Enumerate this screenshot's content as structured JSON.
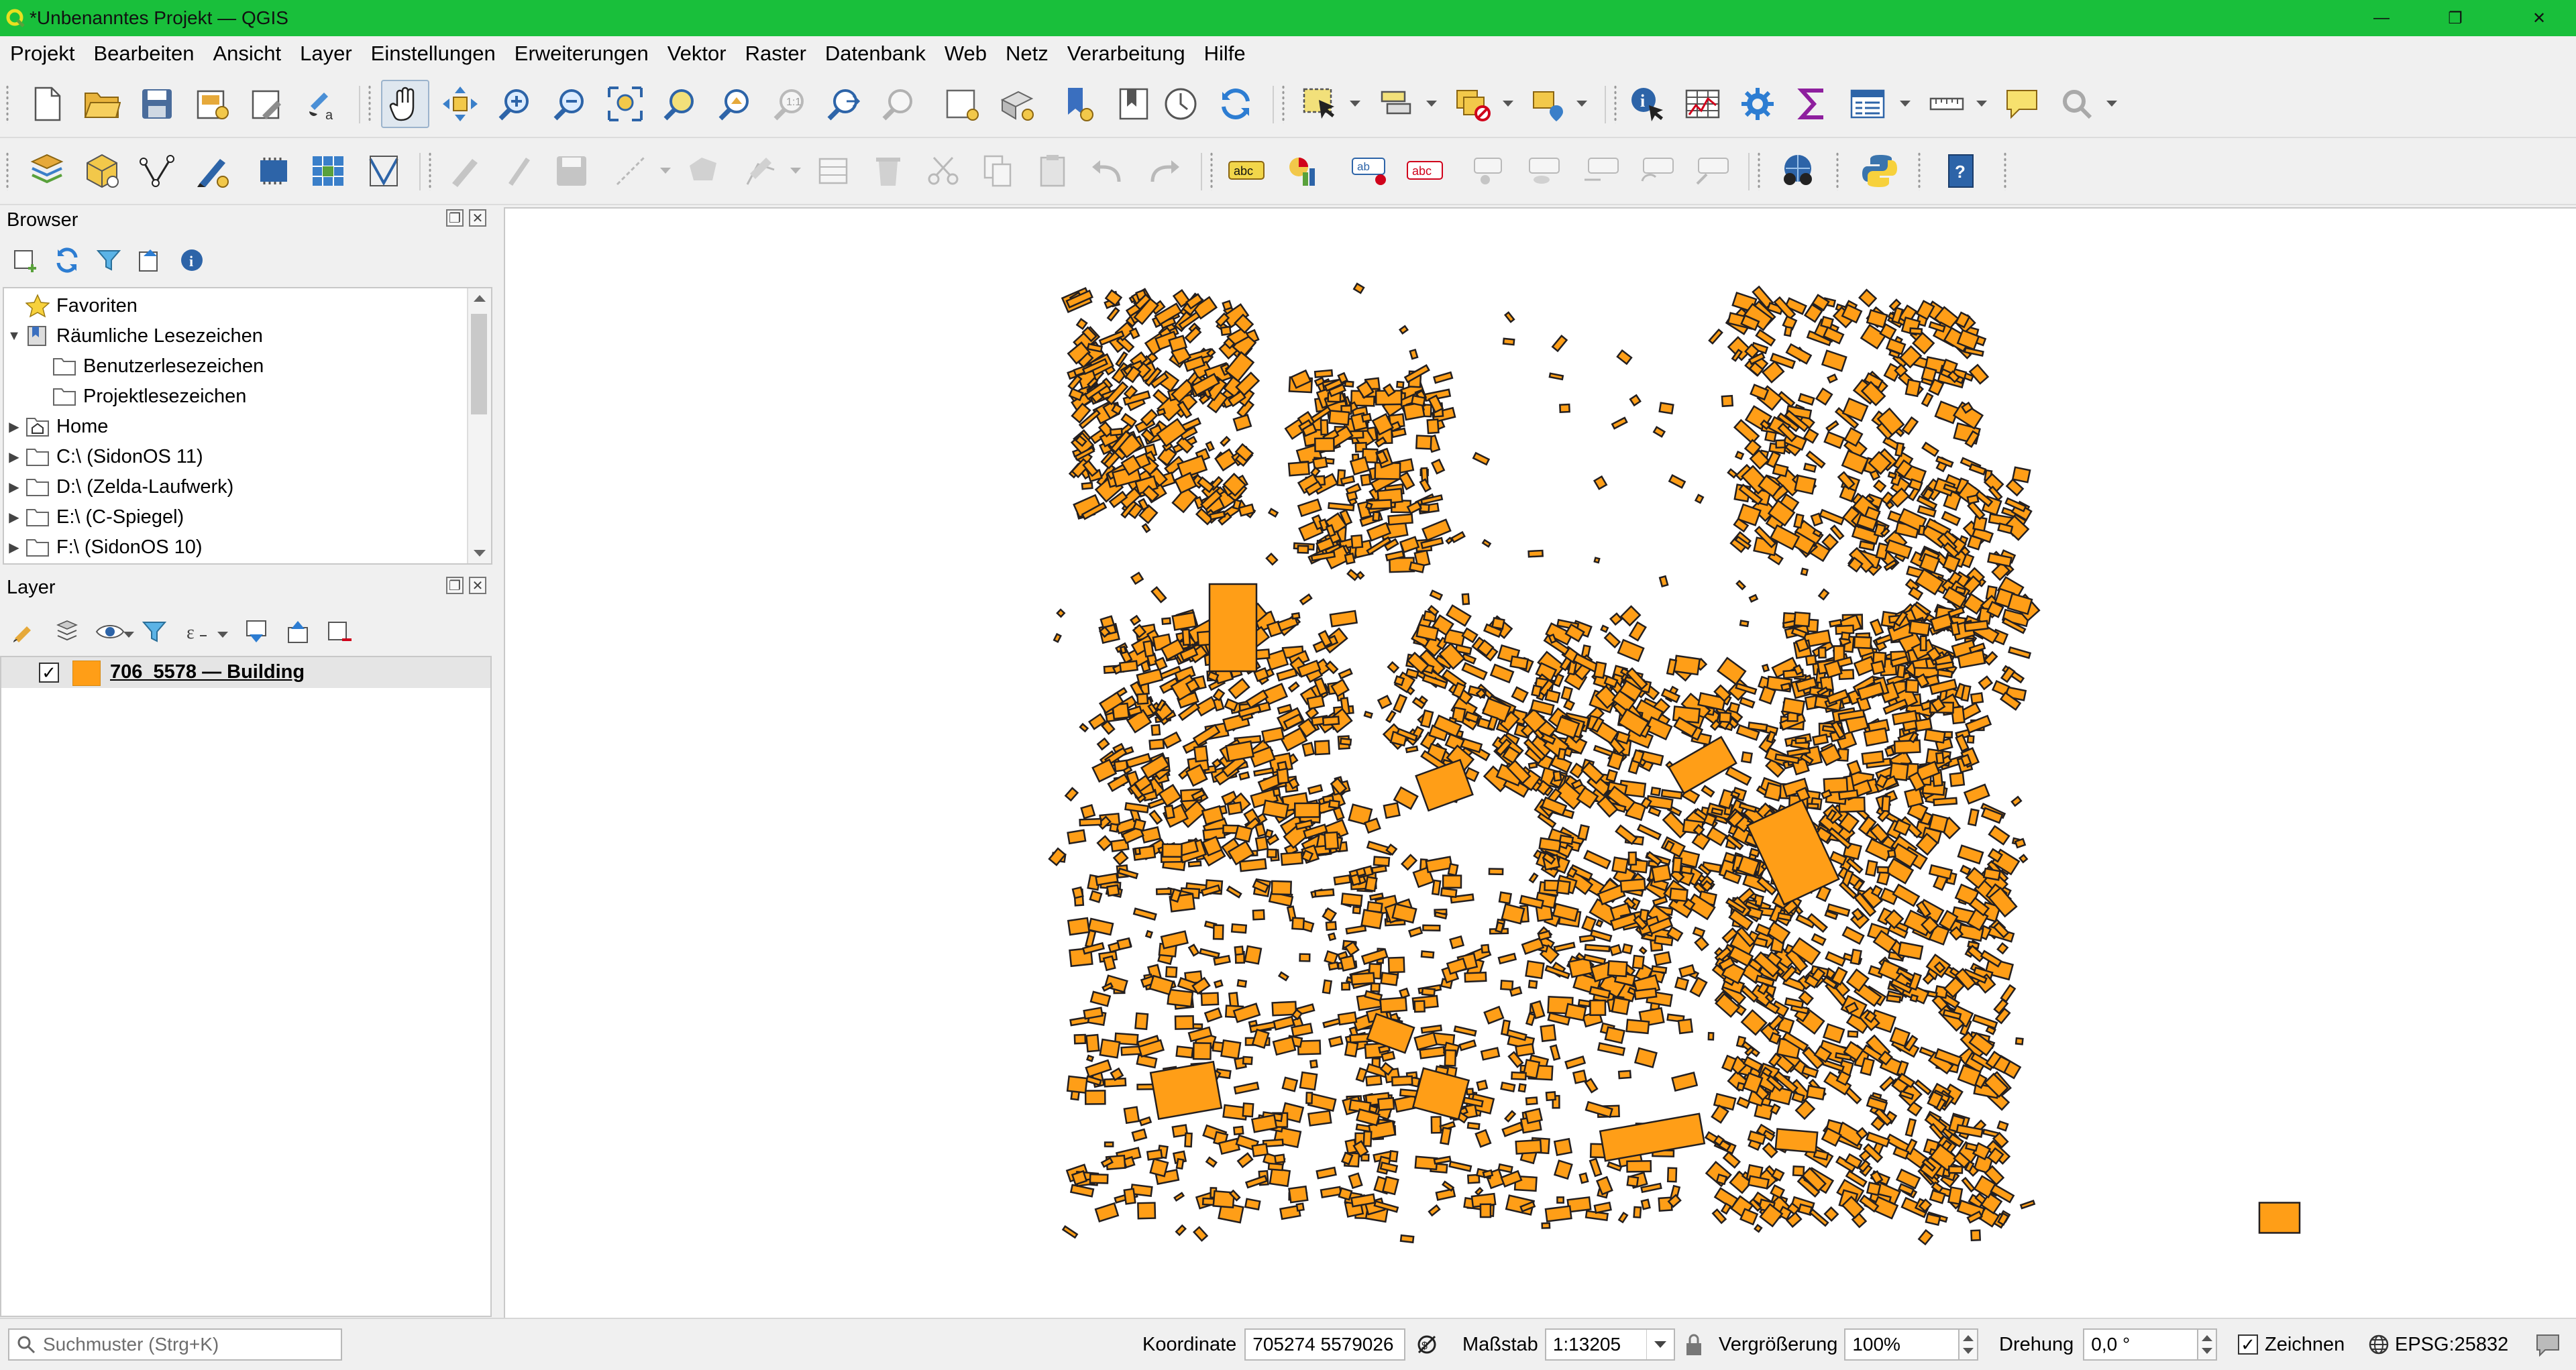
{
  "window": {
    "title": "*Unbenanntes Projekt — QGIS"
  },
  "menubar": {
    "items": [
      "Projekt",
      "Bearbeiten",
      "Ansicht",
      "Layer",
      "Einstellungen",
      "Erweiterungen",
      "Vektor",
      "Raster",
      "Datenbank",
      "Web",
      "Netz",
      "Verarbeitung",
      "Hilfe"
    ]
  },
  "browser": {
    "title": "Browser",
    "items": [
      {
        "label": "Favoriten",
        "icon": "star-icon",
        "expander": ""
      },
      {
        "label": "Räumliche Lesezeichen",
        "icon": "bookmarks-icon",
        "expander": "▼"
      },
      {
        "label": "Benutzerlesezeichen",
        "icon": "folder-icon",
        "expander": ""
      },
      {
        "label": "Projektlesezeichen",
        "icon": "folder-icon",
        "expander": ""
      },
      {
        "label": "Home",
        "icon": "home-folder-icon",
        "expander": "▶"
      },
      {
        "label": "C:\\ (SidonOS 11)",
        "icon": "folder-icon",
        "expander": "▶"
      },
      {
        "label": "D:\\ (Zelda-Laufwerk)",
        "icon": "folder-icon",
        "expander": "▶"
      },
      {
        "label": "E:\\ (C-Spiegel)",
        "icon": "folder-icon",
        "expander": "▶"
      },
      {
        "label": "F:\\ (SidonOS 10)",
        "icon": "folder-icon",
        "expander": "▶"
      }
    ]
  },
  "layers": {
    "title": "Layer",
    "items": [
      {
        "label": "706_5578 — Building",
        "checked": true,
        "color": "#ff9e17"
      }
    ]
  },
  "map": {
    "fill_color": "#ff9e17",
    "stroke_color": "#231f20"
  },
  "statusbar": {
    "search_placeholder": "Suchmuster (Strg+K)",
    "coordinate_label": "Koordinate",
    "coordinate_value": "705274  5579026",
    "scale_label": "Maßstab",
    "scale_value": "1:13205",
    "magnifier_label": "Vergrößerung",
    "magnifier_value": "100%",
    "rotation_label": "Drehung",
    "rotation_value": "0,0 °",
    "render_label": "Zeichnen",
    "crs_label": "EPSG:25832"
  }
}
